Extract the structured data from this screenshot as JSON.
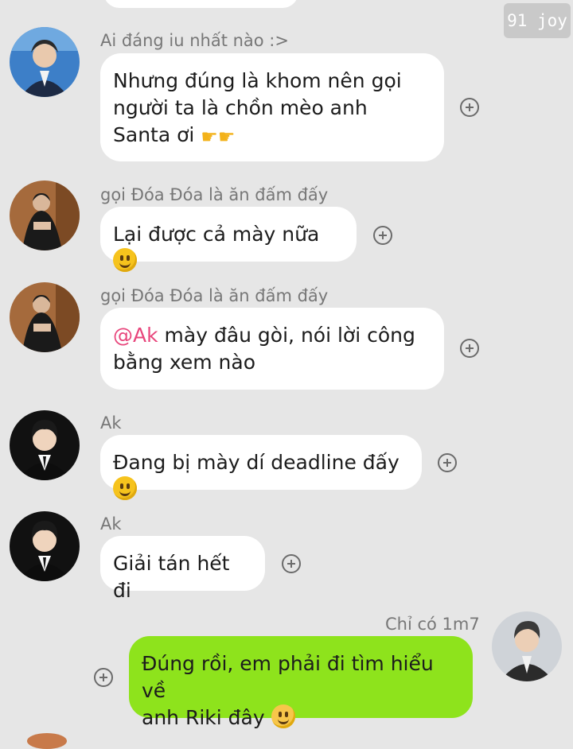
{
  "watermark": "91 joy",
  "messages": [
    {
      "sender": "Ai đáng iu nhất nào :>",
      "lines": [
        "Nhưng đúng là khom nên gọi",
        "người ta là chồn mèo anh",
        "Santa ơi"
      ],
      "trailing_emoji": "👉👉"
    },
    {
      "sender": "gọi Đóa Đóa là ăn đấm đấy",
      "lines": [
        "Lại được cả mày nữa"
      ],
      "trailing_emoji": "🙂"
    },
    {
      "sender": "gọi Đóa Đóa là ăn đấm đấy",
      "mention": "@Ak",
      "lines": [
        " mày đâu gòi, nói lời công",
        "bằng xem nào"
      ]
    },
    {
      "sender": "Ak",
      "lines": [
        "Đang bị mày dí deadline đấy"
      ],
      "trailing_emoji": "🙂"
    },
    {
      "sender": "Ak",
      "lines": [
        "Giải tán hết đi"
      ]
    },
    {
      "sender": "Chỉ có 1m7",
      "lines": [
        "Đúng rồi, em phải đi tìm hiểu về",
        "anh Riki đây"
      ],
      "trailing_emoji": "😊",
      "outgoing": true
    }
  ],
  "colors": {
    "background": "#e6e6e6",
    "incoming_bubble": "#ffffff",
    "outgoing_bubble": "#8ee31c",
    "mention": "#e8467c",
    "sender_name": "#777777"
  },
  "icons": [
    "add-reaction-icon",
    "pointing-hand-emoji",
    "smile-emoji",
    "blush-emoji"
  ]
}
